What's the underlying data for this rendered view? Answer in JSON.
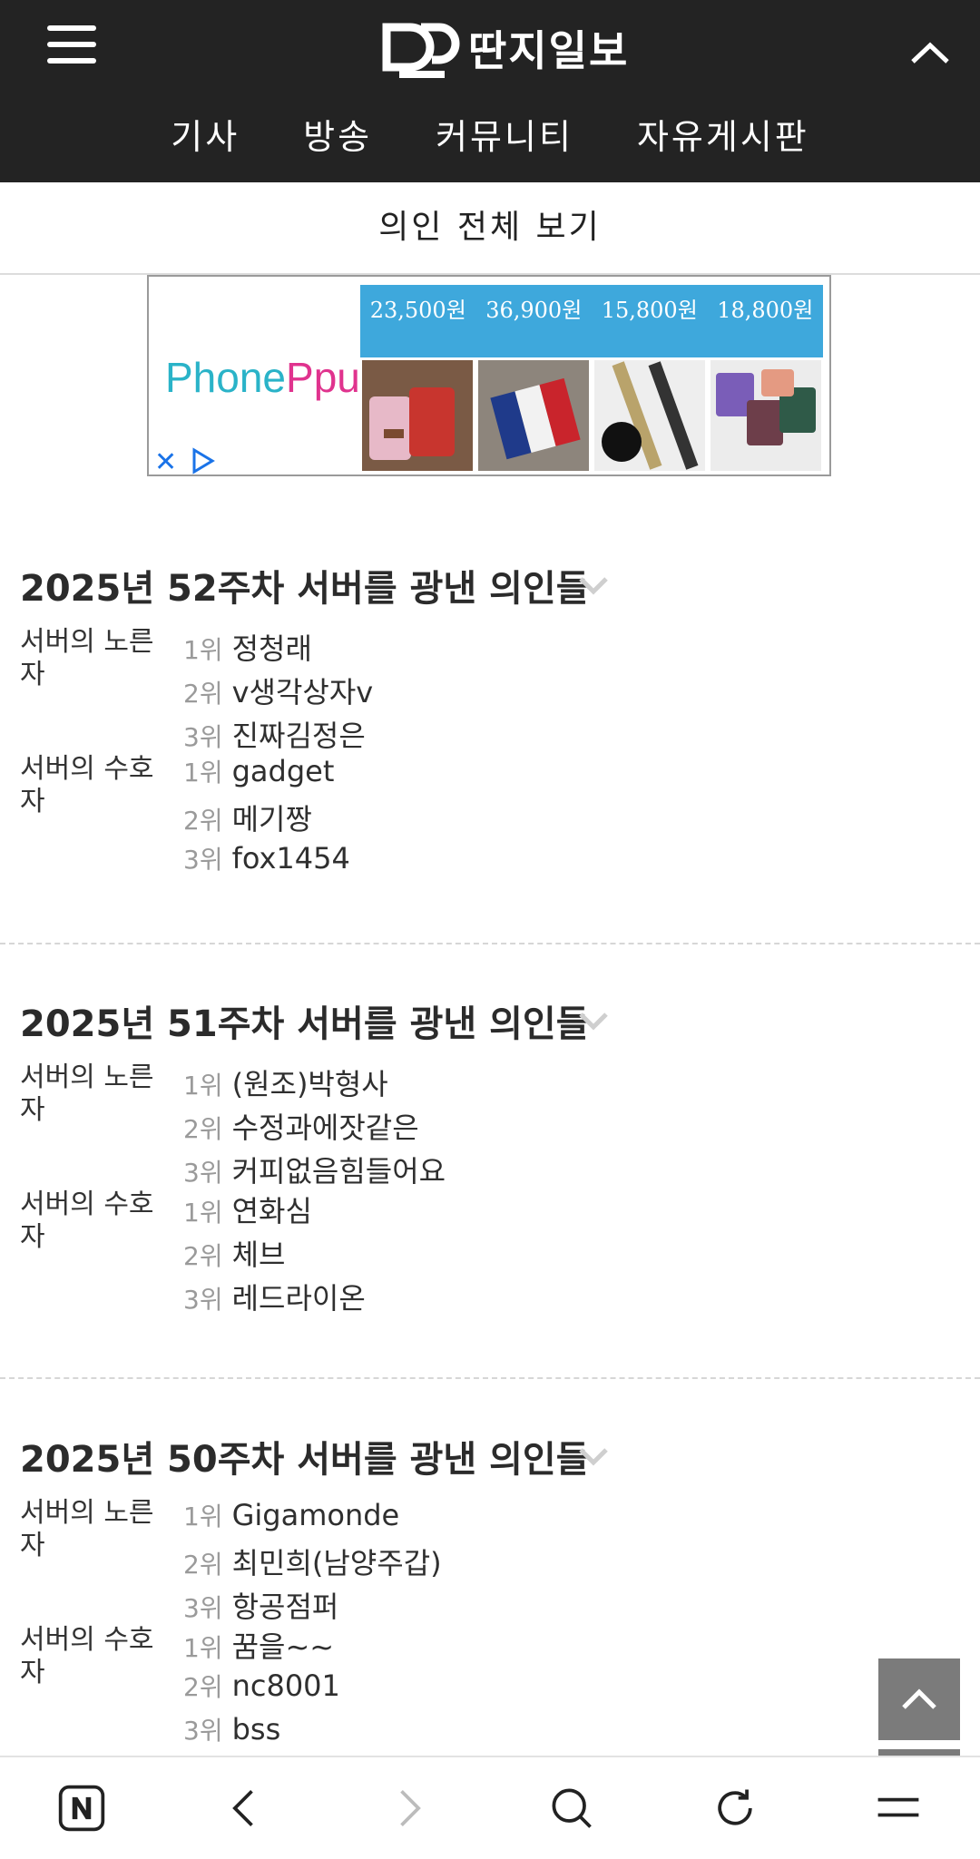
{
  "header": {
    "logo_text": "딴지일보",
    "nav": [
      "기사",
      "방송",
      "커뮤니티",
      "자유게시판"
    ]
  },
  "view_all_label": "의인 전체 보기",
  "ad": {
    "brand_part1": "Phone",
    "brand_part2": "Ppu",
    "prices": [
      "23,500원",
      "36,900원",
      "15,800원",
      "18,800원"
    ],
    "close_symbol": "✕"
  },
  "weeks": [
    {
      "title": "2025년 52주차 서버를 광낸 의인들",
      "groups": [
        {
          "label": "서버의 노른자",
          "entries": [
            {
              "rank": "1위",
              "name": "정청래"
            },
            {
              "rank": "2위",
              "name": "v생각상자v"
            },
            {
              "rank": "3위",
              "name": "진짜김정은"
            }
          ]
        },
        {
          "label": "서버의 수호자",
          "entries": [
            {
              "rank": "1위",
              "name": "gadget"
            },
            {
              "rank": "2위",
              "name": "메기짱"
            },
            {
              "rank": "3위",
              "name": "fox1454"
            }
          ]
        }
      ]
    },
    {
      "title": "2025년 51주차 서버를 광낸 의인들",
      "groups": [
        {
          "label": "서버의 노른자",
          "entries": [
            {
              "rank": "1위",
              "name": "(원조)박형사"
            },
            {
              "rank": "2위",
              "name": "수정과에잣같은"
            },
            {
              "rank": "3위",
              "name": "커피없음힘들어요"
            }
          ]
        },
        {
          "label": "서버의 수호자",
          "entries": [
            {
              "rank": "1위",
              "name": "연화심"
            },
            {
              "rank": "2위",
              "name": "체브"
            },
            {
              "rank": "3위",
              "name": "레드라이온"
            }
          ]
        }
      ]
    },
    {
      "title": "2025년 50주차 서버를 광낸 의인들",
      "groups": [
        {
          "label": "서버의 노른자",
          "entries": [
            {
              "rank": "1위",
              "name": "Gigamonde"
            },
            {
              "rank": "2위",
              "name": "최민희(남양주갑)"
            },
            {
              "rank": "3위",
              "name": "항공점퍼"
            }
          ]
        },
        {
          "label": "서버의 수호자",
          "entries": [
            {
              "rank": "1위",
              "name": "꿈을~~"
            },
            {
              "rank": "2위",
              "name": "nc8001"
            },
            {
              "rank": "3위",
              "name": "bss"
            }
          ]
        }
      ]
    }
  ],
  "bottom_bar_icons": [
    "naver-n-icon",
    "back-icon",
    "forward-icon",
    "search-icon",
    "refresh-icon",
    "menu-icon"
  ]
}
